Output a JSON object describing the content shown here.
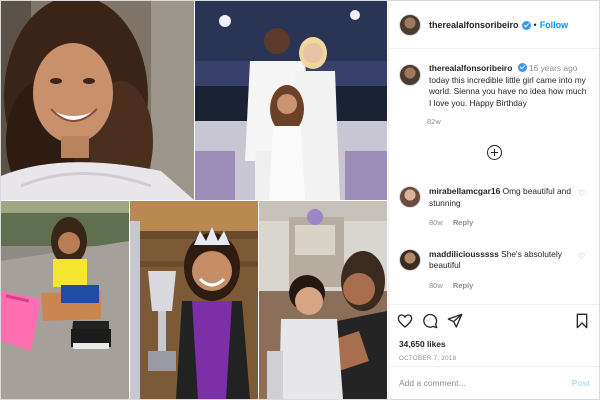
{
  "post": {
    "username": "therealalfonsoribeiro",
    "follow_separator": "•",
    "follow_label": "Follow",
    "verified_icon": "verified-badge-icon",
    "colors": {
      "accent": "#0095f6",
      "text": "#262626",
      "muted": "#8e8e8e",
      "border": "#dbdbdb",
      "post_disabled": "#b2dffc"
    },
    "caption": {
      "username": "therealalfonsoribeiro",
      "time": "16 years ago",
      "text": "today this incredible little girl came into my world. Sienna you have no idea how much I love you. Happy Birthday",
      "age": "82w"
    },
    "load_more_icon": "plus-circle-icon",
    "comments": [
      {
        "username": "mirabellamcgar16",
        "text": "Omg beautiful and stunning",
        "age": "80w",
        "reply_label": "Reply"
      },
      {
        "username": "maddiliciousssss",
        "text": "She's absolutely beautiful",
        "age": "80w",
        "reply_label": "Reply"
      }
    ],
    "actions": {
      "icons": [
        "heart-icon",
        "comment-icon",
        "share-icon",
        "bookmark-icon"
      ],
      "likes": "34,650 likes",
      "date": "OCTOBER 7, 2018"
    },
    "add_comment": {
      "placeholder": "Add a comment...",
      "post_label": "Post"
    }
  }
}
